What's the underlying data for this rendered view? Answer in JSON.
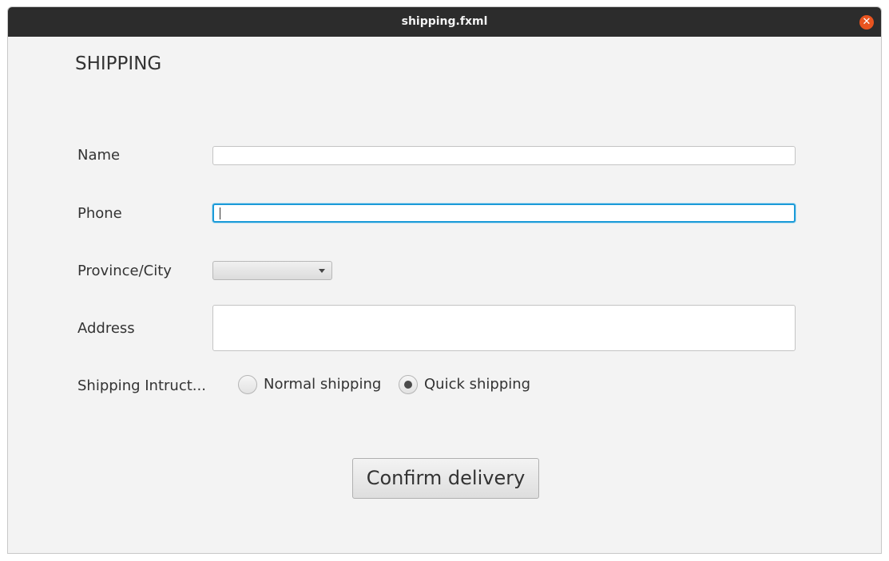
{
  "window": {
    "title": "shipping.fxml",
    "close_glyph": "✕"
  },
  "form": {
    "heading": "SHIPPING",
    "name_label": "Name",
    "name_value": "",
    "phone_label": "Phone",
    "phone_value": "",
    "province_label": "Province/City",
    "province_value": "",
    "address_label": "Address",
    "address_value": "",
    "instructions_label": "Shipping Intruct...",
    "shipping_options": [
      {
        "label": "Normal shipping",
        "selected": false
      },
      {
        "label": "Quick shipping",
        "selected": true
      }
    ],
    "confirm_label": "Confirm delivery"
  },
  "colors": {
    "titlebar": "#2c2c2c",
    "close_button": "#e9541f",
    "focus_ring": "#1c9bd8",
    "background": "#f3f3f3"
  }
}
